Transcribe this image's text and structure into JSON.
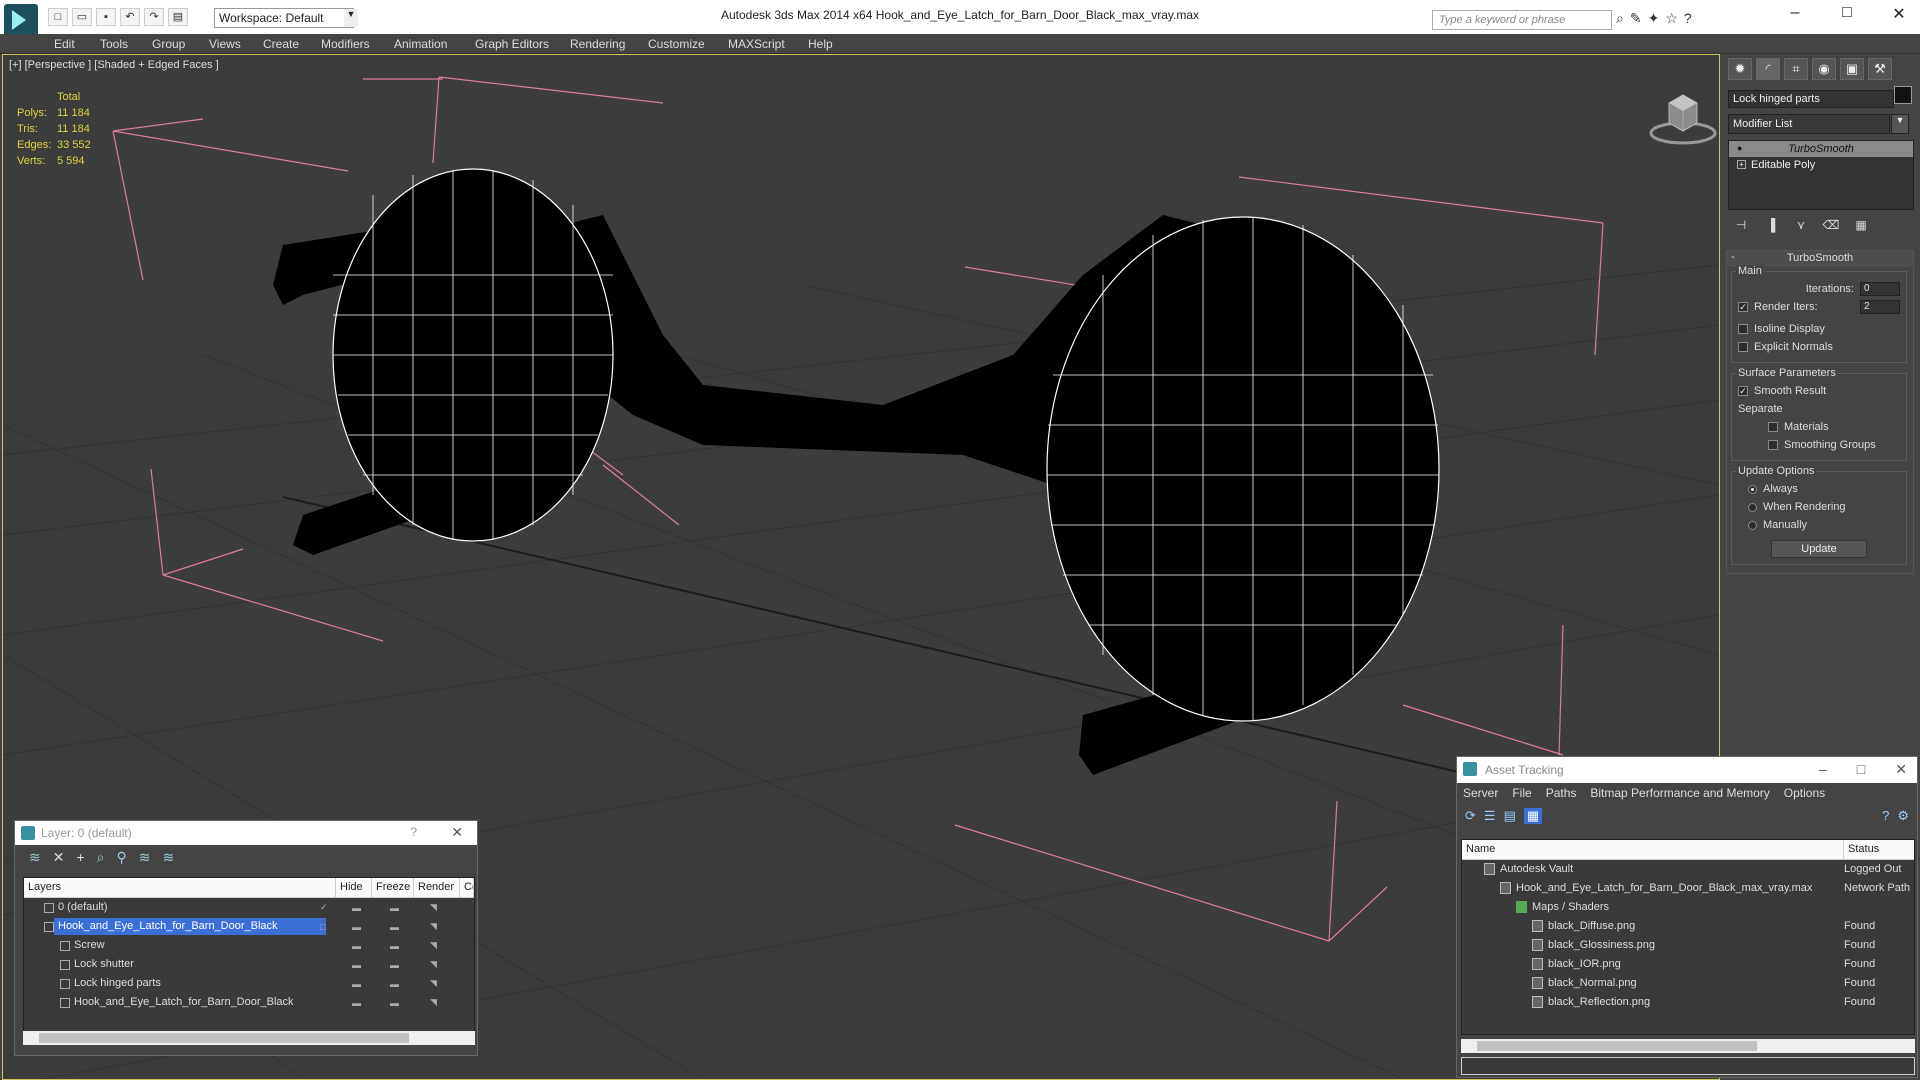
{
  "app": {
    "title": "Autodesk 3ds Max  2014 x64      Hook_and_Eye_Latch_for_Barn_Door_Black_max_vray.max",
    "workspace": "Workspace: Default",
    "search_placeholder": "Type a keyword or phrase"
  },
  "menu": [
    "Edit",
    "Tools",
    "Group",
    "Views",
    "Create",
    "Modifiers",
    "Animation",
    "Graph Editors",
    "Rendering",
    "Customize",
    "MAXScript",
    "Help"
  ],
  "viewport": {
    "label": "[+] [Perspective ] [Shaded + Edged Faces ]",
    "stats": {
      "total_label": "Total",
      "rows": [
        {
          "k": "Polys:",
          "v": "11 184"
        },
        {
          "k": "Tris:",
          "v": "11 184"
        },
        {
          "k": "Edges:",
          "v": "33 552"
        },
        {
          "k": "Verts:",
          "v": "5 594"
        }
      ]
    }
  },
  "command_panel": {
    "object_name": "Lock hinged parts",
    "modifier_list": "Modifier List",
    "stack": [
      "TurboSmooth",
      "Editable Poly"
    ],
    "rollout": {
      "title": "TurboSmooth",
      "main_label": "Main",
      "iterations_label": "Iterations:",
      "iterations_value": "0",
      "render_iters_label": "Render Iters:",
      "render_iters_value": "2",
      "isoline_label": "Isoline Display",
      "explicit_normals_label": "Explicit Normals",
      "surface_label": "Surface Parameters",
      "smooth_result_label": "Smooth Result",
      "separate_label": "Separate",
      "materials_label": "Materials",
      "smoothing_groups_label": "Smoothing Groups",
      "update_options_label": "Update Options",
      "always_label": "Always",
      "when_rendering_label": "When Rendering",
      "manually_label": "Manually",
      "update_button": "Update"
    }
  },
  "layer_window": {
    "title": "Layer: 0 (default)",
    "help": "?",
    "columns": [
      "Layers",
      "Hide",
      "Freeze",
      "Render",
      "Co"
    ],
    "rows": [
      {
        "name": "0 (default)",
        "level": 1
      },
      {
        "name": "Hook_and_Eye_Latch_for_Barn_Door_Black",
        "level": 1
      },
      {
        "name": "Screw",
        "level": 2
      },
      {
        "name": "Lock shutter",
        "level": 2
      },
      {
        "name": "Lock hinged parts",
        "level": 2
      },
      {
        "name": "Hook_and_Eye_Latch_for_Barn_Door_Black",
        "level": 2
      }
    ]
  },
  "asset_window": {
    "title": "Asset Tracking",
    "menu": [
      "Server",
      "File",
      "Paths",
      "Bitmap Performance and Memory",
      "Options"
    ],
    "columns": [
      "Name",
      "Status"
    ],
    "rows": [
      {
        "name": "Autodesk Vault",
        "status": "Logged Out",
        "indent": 1
      },
      {
        "name": "Hook_and_Eye_Latch_for_Barn_Door_Black_max_vray.max",
        "status": "Network Path",
        "indent": 2
      },
      {
        "name": "Maps / Shaders",
        "status": "",
        "indent": 3
      },
      {
        "name": "black_Diffuse.png",
        "status": "Found",
        "indent": 4
      },
      {
        "name": "black_Glossiness.png",
        "status": "Found",
        "indent": 4
      },
      {
        "name": "black_IOR.png",
        "status": "Found",
        "indent": 4
      },
      {
        "name": "black_Normal.png",
        "status": "Found",
        "indent": 4
      },
      {
        "name": "black_Reflection.png",
        "status": "Found",
        "indent": 4
      }
    ]
  }
}
